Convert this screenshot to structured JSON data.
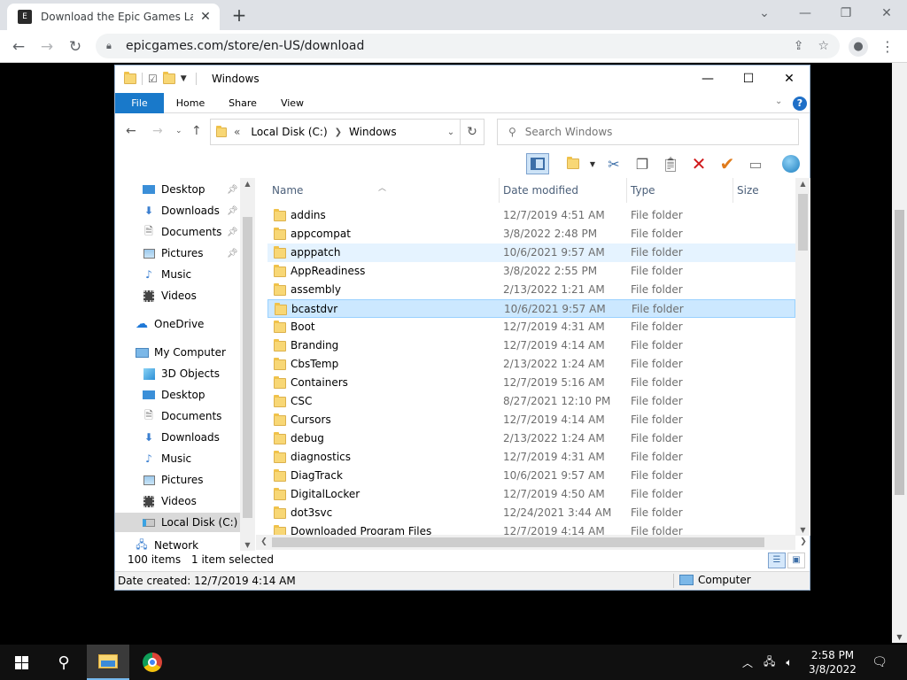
{
  "browser": {
    "tab_title": "Download the Epic Games Launc",
    "tab_favicon": "epic-games-logo",
    "url": "epicgames.com/store/en-US/download",
    "new_tab": "+"
  },
  "explorer": {
    "title": "Windows",
    "ribbon_tabs": [
      {
        "label": "File"
      },
      {
        "label": "Home"
      },
      {
        "label": "Share"
      },
      {
        "label": "View"
      }
    ],
    "help": "?",
    "address": {
      "prefix": "«",
      "crumbs": [
        "Local Disk (C:)",
        "Windows"
      ]
    },
    "search_placeholder": "Search Windows",
    "nav_items": [
      {
        "label": "Desktop",
        "icon": "desktop-icon",
        "pinned": true
      },
      {
        "label": "Downloads",
        "icon": "downloads-icon",
        "pinned": true
      },
      {
        "label": "Documents",
        "icon": "documents-icon",
        "pinned": true
      },
      {
        "label": "Pictures",
        "icon": "pictures-icon",
        "pinned": true
      },
      {
        "label": "Music",
        "icon": "music-icon",
        "pinned": false
      },
      {
        "label": "Videos",
        "icon": "videos-icon",
        "pinned": false
      },
      {
        "label": "OneDrive",
        "icon": "onedrive-icon",
        "pinned": false
      },
      {
        "label": "My Computer",
        "icon": "computer-icon",
        "pinned": false
      },
      {
        "label": "3D Objects",
        "icon": "3d-objects-icon",
        "pinned": false
      },
      {
        "label": "Desktop",
        "icon": "desktop-icon",
        "pinned": false
      },
      {
        "label": "Documents",
        "icon": "documents-icon",
        "pinned": false
      },
      {
        "label": "Downloads",
        "icon": "downloads-icon",
        "pinned": false
      },
      {
        "label": "Music",
        "icon": "music-icon",
        "pinned": false
      },
      {
        "label": "Pictures",
        "icon": "pictures-icon",
        "pinned": false
      },
      {
        "label": "Videos",
        "icon": "videos-icon",
        "pinned": false
      },
      {
        "label": "Local Disk (C:)",
        "icon": "local-disk-icon",
        "pinned": false,
        "selected": true
      },
      {
        "label": "Network",
        "icon": "network-icon",
        "pinned": false
      }
    ],
    "columns": {
      "name": "Name",
      "date": "Date modified",
      "type": "Type",
      "size": "Size"
    },
    "files": [
      {
        "name": "addins",
        "date": "12/7/2019 4:51 AM",
        "type": "File folder"
      },
      {
        "name": "appcompat",
        "date": "3/8/2022 2:48 PM",
        "type": "File folder"
      },
      {
        "name": "apppatch",
        "date": "10/6/2021 9:57 AM",
        "type": "File folder",
        "state": "hover"
      },
      {
        "name": "AppReadiness",
        "date": "3/8/2022 2:55 PM",
        "type": "File folder"
      },
      {
        "name": "assembly",
        "date": "2/13/2022 1:21 AM",
        "type": "File folder"
      },
      {
        "name": "bcastdvr",
        "date": "10/6/2021 9:57 AM",
        "type": "File folder",
        "state": "selected"
      },
      {
        "name": "Boot",
        "date": "12/7/2019 4:31 AM",
        "type": "File folder"
      },
      {
        "name": "Branding",
        "date": "12/7/2019 4:14 AM",
        "type": "File folder"
      },
      {
        "name": "CbsTemp",
        "date": "2/13/2022 1:24 AM",
        "type": "File folder"
      },
      {
        "name": "Containers",
        "date": "12/7/2019 5:16 AM",
        "type": "File folder"
      },
      {
        "name": "CSC",
        "date": "8/27/2021 12:10 PM",
        "type": "File folder"
      },
      {
        "name": "Cursors",
        "date": "12/7/2019 4:14 AM",
        "type": "File folder"
      },
      {
        "name": "debug",
        "date": "2/13/2022 1:24 AM",
        "type": "File folder"
      },
      {
        "name": "diagnostics",
        "date": "12/7/2019 4:31 AM",
        "type": "File folder"
      },
      {
        "name": "DiagTrack",
        "date": "10/6/2021 9:57 AM",
        "type": "File folder"
      },
      {
        "name": "DigitalLocker",
        "date": "12/7/2019 4:50 AM",
        "type": "File folder"
      },
      {
        "name": "dot3svc",
        "date": "12/24/2021 3:44 AM",
        "type": "File folder"
      },
      {
        "name": "Downloaded Program Files",
        "date": "12/7/2019 4:14 AM",
        "type": "File folder"
      }
    ],
    "status": {
      "item_count": "100 items",
      "selection": "1 item selected",
      "detail": "Date created: 12/7/2019 4:14 AM",
      "location": "Computer"
    }
  },
  "taskbar": {
    "time": "2:58 PM",
    "date": "3/8/2022"
  },
  "colors": {
    "file_tab": "#1979ca",
    "selection": "#cce8ff",
    "hover": "#e5f3ff",
    "delete_x": "#d0191b",
    "check": "#e07b1c"
  }
}
